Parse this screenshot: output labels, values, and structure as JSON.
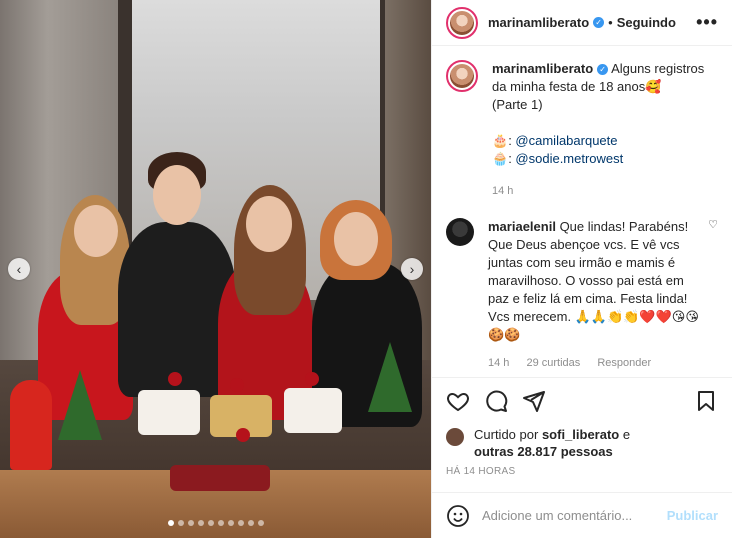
{
  "post": {
    "username": "marinamliberato",
    "follow_status": "Seguindo",
    "more_label": "•••",
    "caption_line1": "Alguns registros da minha festa de 18 anos🥰",
    "caption_line2": "(Parte 1)",
    "credit1_emoji": "🎂",
    "credit1": "@camilabarquete",
    "credit2_emoji": "🧁",
    "credit2": "@sodie.metrowest",
    "caption_time": "14 h"
  },
  "comment": {
    "username": "mariaelenil",
    "text": "Que lindas! Parabéns! Que Deus abençoe vcs. E vê vcs juntas com seu irmão e mamis é maravilhoso. O vosso pai está em paz e feliz lá em cima. Festa linda! Vcs merecem. 🙏🙏👏👏❤️❤️😘😘🍪🍪",
    "time": "14 h",
    "likes": "29 curtidas",
    "reply": "Responder"
  },
  "likes": {
    "prefix": "Curtido por",
    "user": "sofi_liberato",
    "middle": "e",
    "others": "outras 28.817 pessoas"
  },
  "timestamp": "HÁ 14 HORAS",
  "comment_box": {
    "placeholder": "Adicione um comentário...",
    "post_label": "Publicar"
  },
  "carousel": {
    "prev": "‹",
    "next": "›",
    "count": 10,
    "active": 0
  },
  "colors": {
    "verified": "#3897f0",
    "link": "#00376b",
    "publish_disabled": "#b2dffc"
  },
  "icons": [
    "heart-icon",
    "comment-icon",
    "share-icon",
    "bookmark-icon",
    "emoji-icon",
    "verified-icon",
    "more-icon"
  ]
}
